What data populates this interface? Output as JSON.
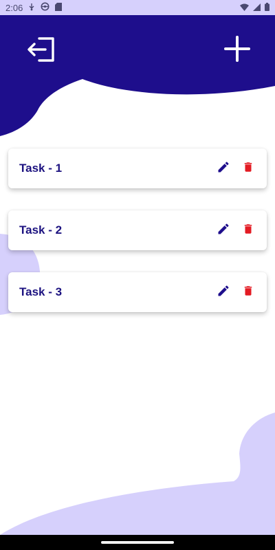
{
  "status_bar": {
    "time": "2:06",
    "icons": [
      "usb-debug-icon",
      "android-icon",
      "sd-card-icon",
      "wifi-icon",
      "signal-icon",
      "battery-icon"
    ]
  },
  "header": {
    "logout_icon": "logout-icon",
    "add_icon": "plus-icon"
  },
  "tasks": [
    {
      "title": "Task - 1",
      "edit_icon": "pencil-icon",
      "delete_icon": "trash-icon"
    },
    {
      "title": "Task - 2",
      "edit_icon": "pencil-icon",
      "delete_icon": "trash-icon"
    },
    {
      "title": "Task - 3",
      "edit_icon": "pencil-icon",
      "delete_icon": "trash-icon"
    }
  ],
  "colors": {
    "primary": "#1e0e8c",
    "accent_light": "#d6d0fc",
    "task_text": "#1c1280",
    "delete": "#e31b23",
    "background": "#ffffff"
  }
}
